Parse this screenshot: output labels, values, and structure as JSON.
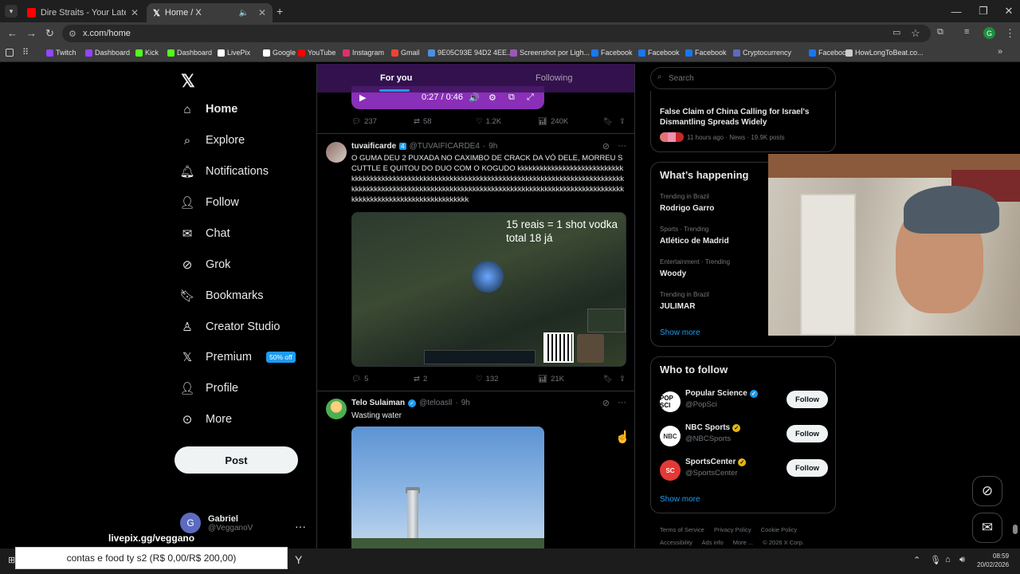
{
  "browser": {
    "tabs": [
      {
        "title": "Dire Straits - Your Latest Trick (",
        "favicon_color": "#ff0000"
      },
      {
        "title": "Home / X",
        "favicon_color": "#ffffff"
      }
    ],
    "url": "x.com/home",
    "bookmarks": [
      {
        "label": "Twitch",
        "color": "#9146ff"
      },
      {
        "label": "Dashboard",
        "color": "#9146ff"
      },
      {
        "label": "Kick",
        "color": "#53fc18"
      },
      {
        "label": "Dashboard",
        "color": "#53fc18"
      },
      {
        "label": "LivePix",
        "color": "#ffffff"
      },
      {
        "label": "Google",
        "color": "#ffffff"
      },
      {
        "label": "YouTube",
        "color": "#ff0000"
      },
      {
        "label": "Instagram",
        "color": "#e1306c"
      },
      {
        "label": "Gmail",
        "color": "#ea4335"
      },
      {
        "label": "9E05C93E 94D2 4EE...",
        "color": "#4a90e2"
      },
      {
        "label": "Screenshot por Ligh...",
        "color": "#9b59b6"
      },
      {
        "label": "Facebook",
        "color": "#1877f2"
      },
      {
        "label": "Facebook",
        "color": "#1877f2"
      },
      {
        "label": "Facebook",
        "color": "#1877f2"
      },
      {
        "label": "Cryptocurrency",
        "color": "#5c6bc0"
      },
      {
        "label": "Facebook",
        "color": "#1877f2"
      },
      {
        "label": "HowLongToBeat.co...",
        "color": "#cccccc"
      }
    ]
  },
  "nav": {
    "items": [
      {
        "label": "Home",
        "icon": "home-icon"
      },
      {
        "label": "Explore",
        "icon": "search-icon"
      },
      {
        "label": "Notifications",
        "icon": "bell-icon"
      },
      {
        "label": "Follow",
        "icon": "person-plus-icon"
      },
      {
        "label": "Chat",
        "icon": "mail-icon"
      },
      {
        "label": "Grok",
        "icon": "grok-icon"
      },
      {
        "label": "Bookmarks",
        "icon": "bookmark-icon"
      },
      {
        "label": "Creator Studio",
        "icon": "creator-icon"
      },
      {
        "label": "Premium",
        "icon": "x-icon"
      },
      {
        "label": "Profile",
        "icon": "person-icon"
      },
      {
        "label": "More",
        "icon": "more-circle-icon"
      }
    ],
    "premium_badge": "50% off",
    "post_button": "Post",
    "account": {
      "name": "Gabriel",
      "handle": "@VegganoV",
      "initial": "G"
    }
  },
  "timeline": {
    "tabs": [
      "For you",
      "Following"
    ],
    "video_time": "0:27 / 0:46",
    "tweet0_actions": {
      "replies": "237",
      "reposts": "58",
      "likes": "1.2K",
      "views": "240K"
    },
    "tweet1": {
      "name": "tuvaificarde",
      "badge": "4",
      "handle": "@TUVAIFICARDE4",
      "time": "9h",
      "text": "O GUMA DEU 2 PUXADA NO CAXIMBO DE CRACK DA VÓ DELE, MORREU SCUTTLE E QUITOU DO DUO COM O KOGUDO kkkkkkkkkkkkkkkkkkkkkkkkkkkkkkkkkkkkkkkkkkkkkkkkkkkkkkkkkkkkkkkkkkkkkkkkkkkkkkkkkkkkkkkkkkkkkkkkkkkkkkkkkkkkkkkkkkkkkkkkkkkkkkkkkkkkkkkkkkkkkkkkkkkkkkkkkkkkkkkkkkkkkkkkkkkkkkkkkkkkkkkkkkkkkkkkkkkkkkkkkkk",
      "overlay_line1": "15 reais = 1 shot vodka",
      "overlay_line2": "total 18 já",
      "actions": {
        "replies": "5",
        "reposts": "2",
        "likes": "132",
        "views": "21K"
      }
    },
    "tweet2": {
      "name": "Telo Sulaiman",
      "handle": "@teloasll",
      "time": "9h",
      "text": "Wasting water"
    }
  },
  "right": {
    "search_placeholder": "Search",
    "news": {
      "title": "False Claim of China Calling for Israel's Dismantling Spreads Widely",
      "meta": "11 hours ago · News · 19.9K posts"
    },
    "whats_happening": {
      "title": "What’s happening",
      "trends": [
        {
          "category": "Trending in Brazil",
          "name": "Rodrigo Garro"
        },
        {
          "category": "Sports · Trending",
          "name": "Atlético de Madrid"
        },
        {
          "category": "Entertainment · Trending",
          "name": "Woody"
        },
        {
          "category": "Trending in Brazil",
          "name": "JULIMAR"
        }
      ],
      "show_more": "Show more"
    },
    "who_to_follow": {
      "title": "Who to follow",
      "accounts": [
        {
          "name": "Popular Science",
          "handle": "@PopSci",
          "avatar_text": "POP SCI",
          "follow": "Follow"
        },
        {
          "name": "NBC Sports",
          "handle": "@NBCSports",
          "avatar_text": "NBC",
          "follow": "Follow"
        },
        {
          "name": "SportsCenter",
          "handle": "@SportsCenter",
          "avatar_text": "SC",
          "follow": "Follow"
        }
      ],
      "show_more": "Show more"
    },
    "footer": [
      "Terms of Service",
      "Privacy Policy",
      "Cookie Policy",
      "Accessibility",
      "Ads info",
      "More ...",
      "© 2026 X Corp."
    ]
  },
  "overlay": {
    "livepix": "livepix.gg/veggano",
    "goal": "contas e food ty s2 (R$ 0,00/R$ 200,00)"
  },
  "taskbar": {
    "time": "08:59",
    "date": "20/02/2026"
  }
}
